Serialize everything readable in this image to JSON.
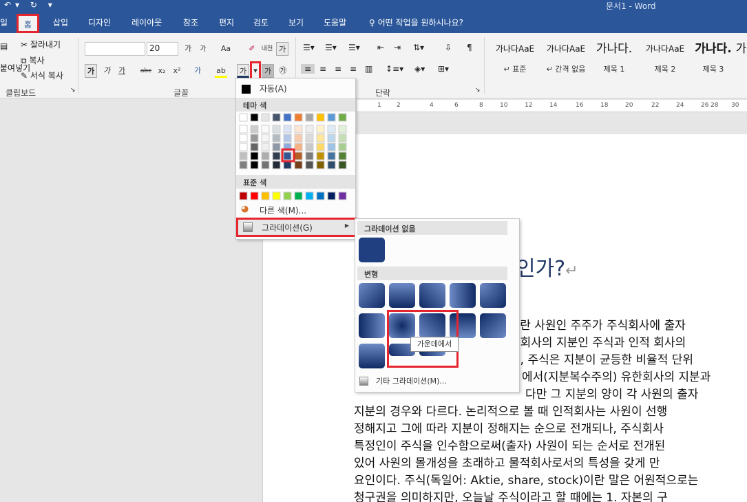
{
  "title": {
    "app": "문서1 - Word"
  },
  "tabs": [
    "일",
    "홈",
    "삽입",
    "디자인",
    "레이아웃",
    "참조",
    "편지",
    "검토",
    "보기",
    "도움말"
  ],
  "tell_me": "어떤 작업을 원하시나요?",
  "clipboard": {
    "paste": "붙여넣기",
    "cut": "잘라내기",
    "copy": "복사",
    "format_painter": "서식 복사",
    "label": "클립보드"
  },
  "font": {
    "name_value": "",
    "size_value": "20",
    "grow": "가",
    "shrink": "가",
    "case": "Aa",
    "clear": "✐",
    "phonetic": "내천",
    "border": "가",
    "bold": "가",
    "italic": "가",
    "underline": "가",
    "strike": "abc",
    "subscript": "x₂",
    "superscript": "x²",
    "effects": "가",
    "highlight": "ab",
    "font_color": "가",
    "shading": "가",
    "enclose": "㉮",
    "label": "글꼴"
  },
  "paragraph": {
    "label": "단락"
  },
  "styles": [
    {
      "preview": "가나다AaE",
      "name": "↵ 표준"
    },
    {
      "preview": "가나다AaE",
      "name": "↵ 간격 없음"
    },
    {
      "preview": "가나다.",
      "name": "제목 1"
    },
    {
      "preview": "가나다AaE",
      "name": "제목 2"
    },
    {
      "preview": "가나다.",
      "name": "제목 3"
    },
    {
      "preview": "가",
      "name": ""
    }
  ],
  "ruler": [
    "1",
    "2",
    "4",
    "6",
    "8",
    "10",
    "12",
    "14",
    "16",
    "18",
    "20",
    "22",
    "24",
    "26",
    "28",
    "30"
  ],
  "color_menu": {
    "automatic": "자동(A)",
    "theme_colors": "테마 색",
    "standard_colors": "표준 색",
    "more_colors": "다른 색(M)...",
    "gradient": "그라데이션(G)",
    "theme_row": [
      "#ffffff",
      "#000000",
      "#e7e6e6",
      "#44546a",
      "#4472c4",
      "#ed7d31",
      "#a5a5a5",
      "#ffc000",
      "#5b9bd5",
      "#70ad47"
    ],
    "standard_row": [
      "#c00000",
      "#ff0000",
      "#ffc000",
      "#ffff00",
      "#92d050",
      "#00b050",
      "#00b0f0",
      "#0070c0",
      "#002060",
      "#7030a0"
    ]
  },
  "gradient_menu": {
    "no_gradient": "그라데이션 없음",
    "variations": "변형",
    "more_gradients": "기타 그라데이션(M)...",
    "tooltip": "가운데에서"
  },
  "document": {
    "heading": "인가?",
    "lines": [
      ")이란 사원인 주주가 주식회사에 출자",
      "식회사의 지분인 주식과 인적 회사의",
      "나, 주식은 지분이 균등한 비율적 단위",
      "에서(지분복수주의) 유한회사의 지분과",
      "다만 그 지분의 양이 각 사원의 출자",
      "지분의 경우와 다르다. 논리적으로 볼 때 인적회사는 사원이 선행",
      "정해지고 그에 따라 지분이 정해지는 순으로 전개되나, 주식회사",
      "특정인이 주식을 인수함으로써(출자) 사원이 되는 순서로 전개된",
      "있어 사원의 몰개성을 초래하고 물적회사로서의 특성을 갖게 만",
      "요인이다. 주식(독일어: Aktie, share, stock)이란 말은 어원적으로는",
      "청구권을 의미하지만, 오늘날 주식이라고 할 때에는 1. 자본의 구"
    ]
  }
}
